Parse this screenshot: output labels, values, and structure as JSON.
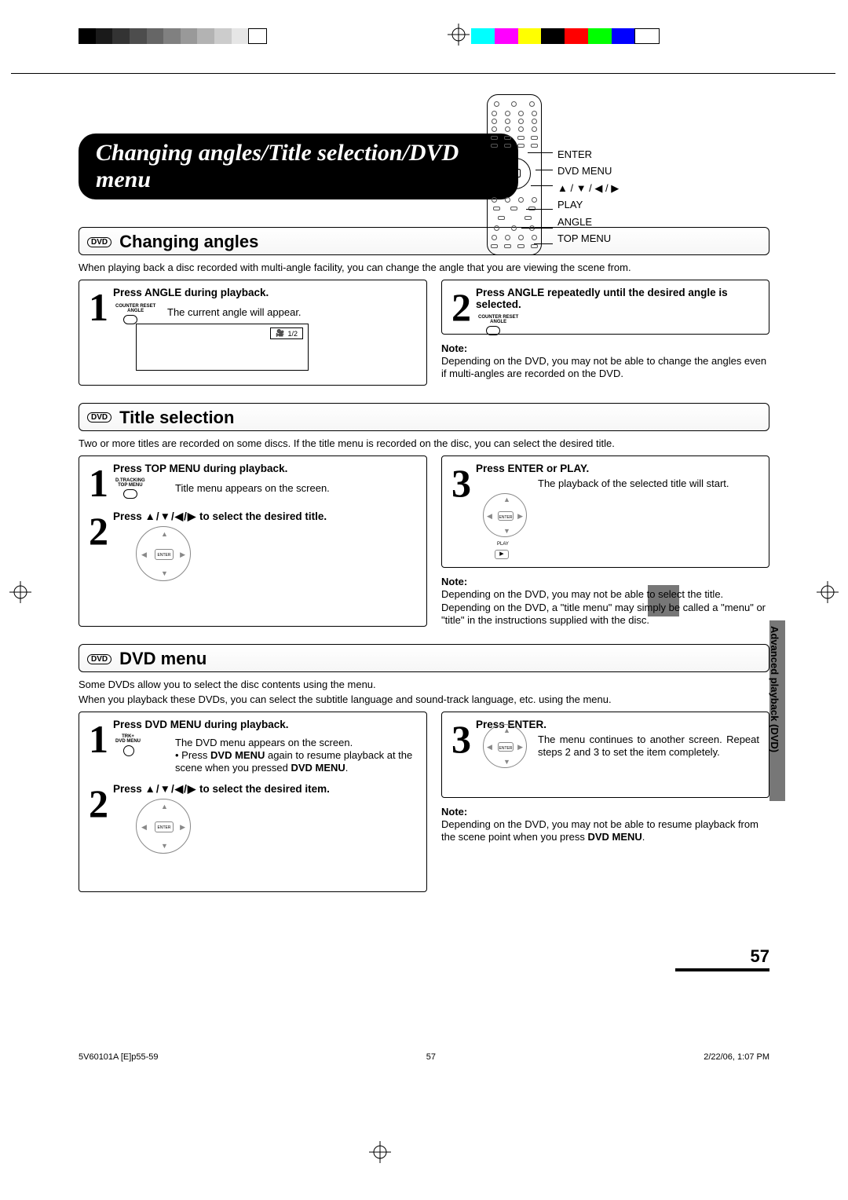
{
  "crop": {
    "c": [
      "#000",
      "#222",
      "#444",
      "#666",
      "#888",
      "#aaa",
      "#ccc",
      "#eee",
      "#fff",
      "#000"
    ],
    "c2": [
      "#00ffff",
      "#ff00ff",
      "#ffff00",
      "#ff0000",
      "#00ff00",
      "#0000ff",
      "#ffffff",
      "#000000"
    ]
  },
  "page_title": "Changing angles/Title selection/DVD menu",
  "remote_labels": {
    "enter": "ENTER",
    "dvd_menu": "DVD MENU",
    "arrows": "▲ / ▼ / ◀ / ▶",
    "play": "PLAY",
    "angle": "ANGLE",
    "top_menu": "TOP MENU"
  },
  "section1": {
    "badge": "DVD",
    "title": "Changing angles",
    "intro": "When playing back a disc recorded with multi-angle facility, you can change the angle that you are viewing the scene from.",
    "step1_title": "Press ANGLE during playback.",
    "step1_body": "The current angle will appear.",
    "step1_btn_label": "COUNTER RESET\nANGLE",
    "osd": "1/2",
    "step2_title": "Press ANGLE repeatedly until the desired angle is selected.",
    "step2_btn_label": "COUNTER RESET\nANGLE",
    "note_label": "Note:",
    "note_body": "Depending on the DVD, you may not be able to change the angles even if multi-angles are recorded on the DVD."
  },
  "section2": {
    "badge": "DVD",
    "title": "Title selection",
    "intro": "Two or more titles are recorded on some discs. If the title menu is recorded on the disc, you can select the desired title.",
    "step1_title": "Press TOP MENU during playback.",
    "step1_body": "Title menu appears on the screen.",
    "step1_btn_label": "D.TRACKING\nTOP MENU",
    "step2_title_a": "Press ",
    "step2_title_b": "▲/▼/◀/▶",
    "step2_title_c": " to select the desired title.",
    "step3_title": "Press ENTER or PLAY.",
    "step3_body": "The playback of the selected title will start.",
    "step3_play_label": "PLAY",
    "note_label": "Note:",
    "note_body": "Depending on the DVD, you may not be able to select the title. Depending on the DVD, a \"title menu\" may simply be called a \"menu\" or \"title\" in the instructions supplied with the disc."
  },
  "section3": {
    "badge": "DVD",
    "title": "DVD menu",
    "intro_a": "Some DVDs allow you to select the disc contents using the menu.",
    "intro_b": "When you playback these DVDs, you can select the subtitle language and sound-track language, etc. using the menu.",
    "step1_title": "Press DVD MENU during playback.",
    "step1_body_a": "The DVD menu appears on the screen.",
    "step1_body_b": "Press ",
    "step1_body_b2": "DVD MENU",
    "step1_body_b3": " again to resume playback at the scene when you pressed ",
    "step1_body_b4": "DVD MENU",
    "step1_body_b5": ".",
    "step1_btn_label": "TRK+\nDVD MENU",
    "step2_title_a": "Press ",
    "step2_title_b": "▲/▼/◀/▶",
    "step2_title_c": " to select the desired item.",
    "step3_title": "Press ENTER.",
    "step3_body": "The menu continues to another screen. Repeat steps 2 and 3 to set the item completely.",
    "note_label": "Note:",
    "note_body_a": "Depending on the DVD, you may not be able to resume playback from the scene point when you press ",
    "note_body_b": "DVD MENU",
    "note_body_c": "."
  },
  "sidebar": "Advanced playback (DVD)",
  "page_number": "57",
  "footer": {
    "left": "5V60101A [E]p55-59",
    "mid": "57",
    "right": "2/22/06, 1:07 PM"
  },
  "enter_label": "ENTER"
}
